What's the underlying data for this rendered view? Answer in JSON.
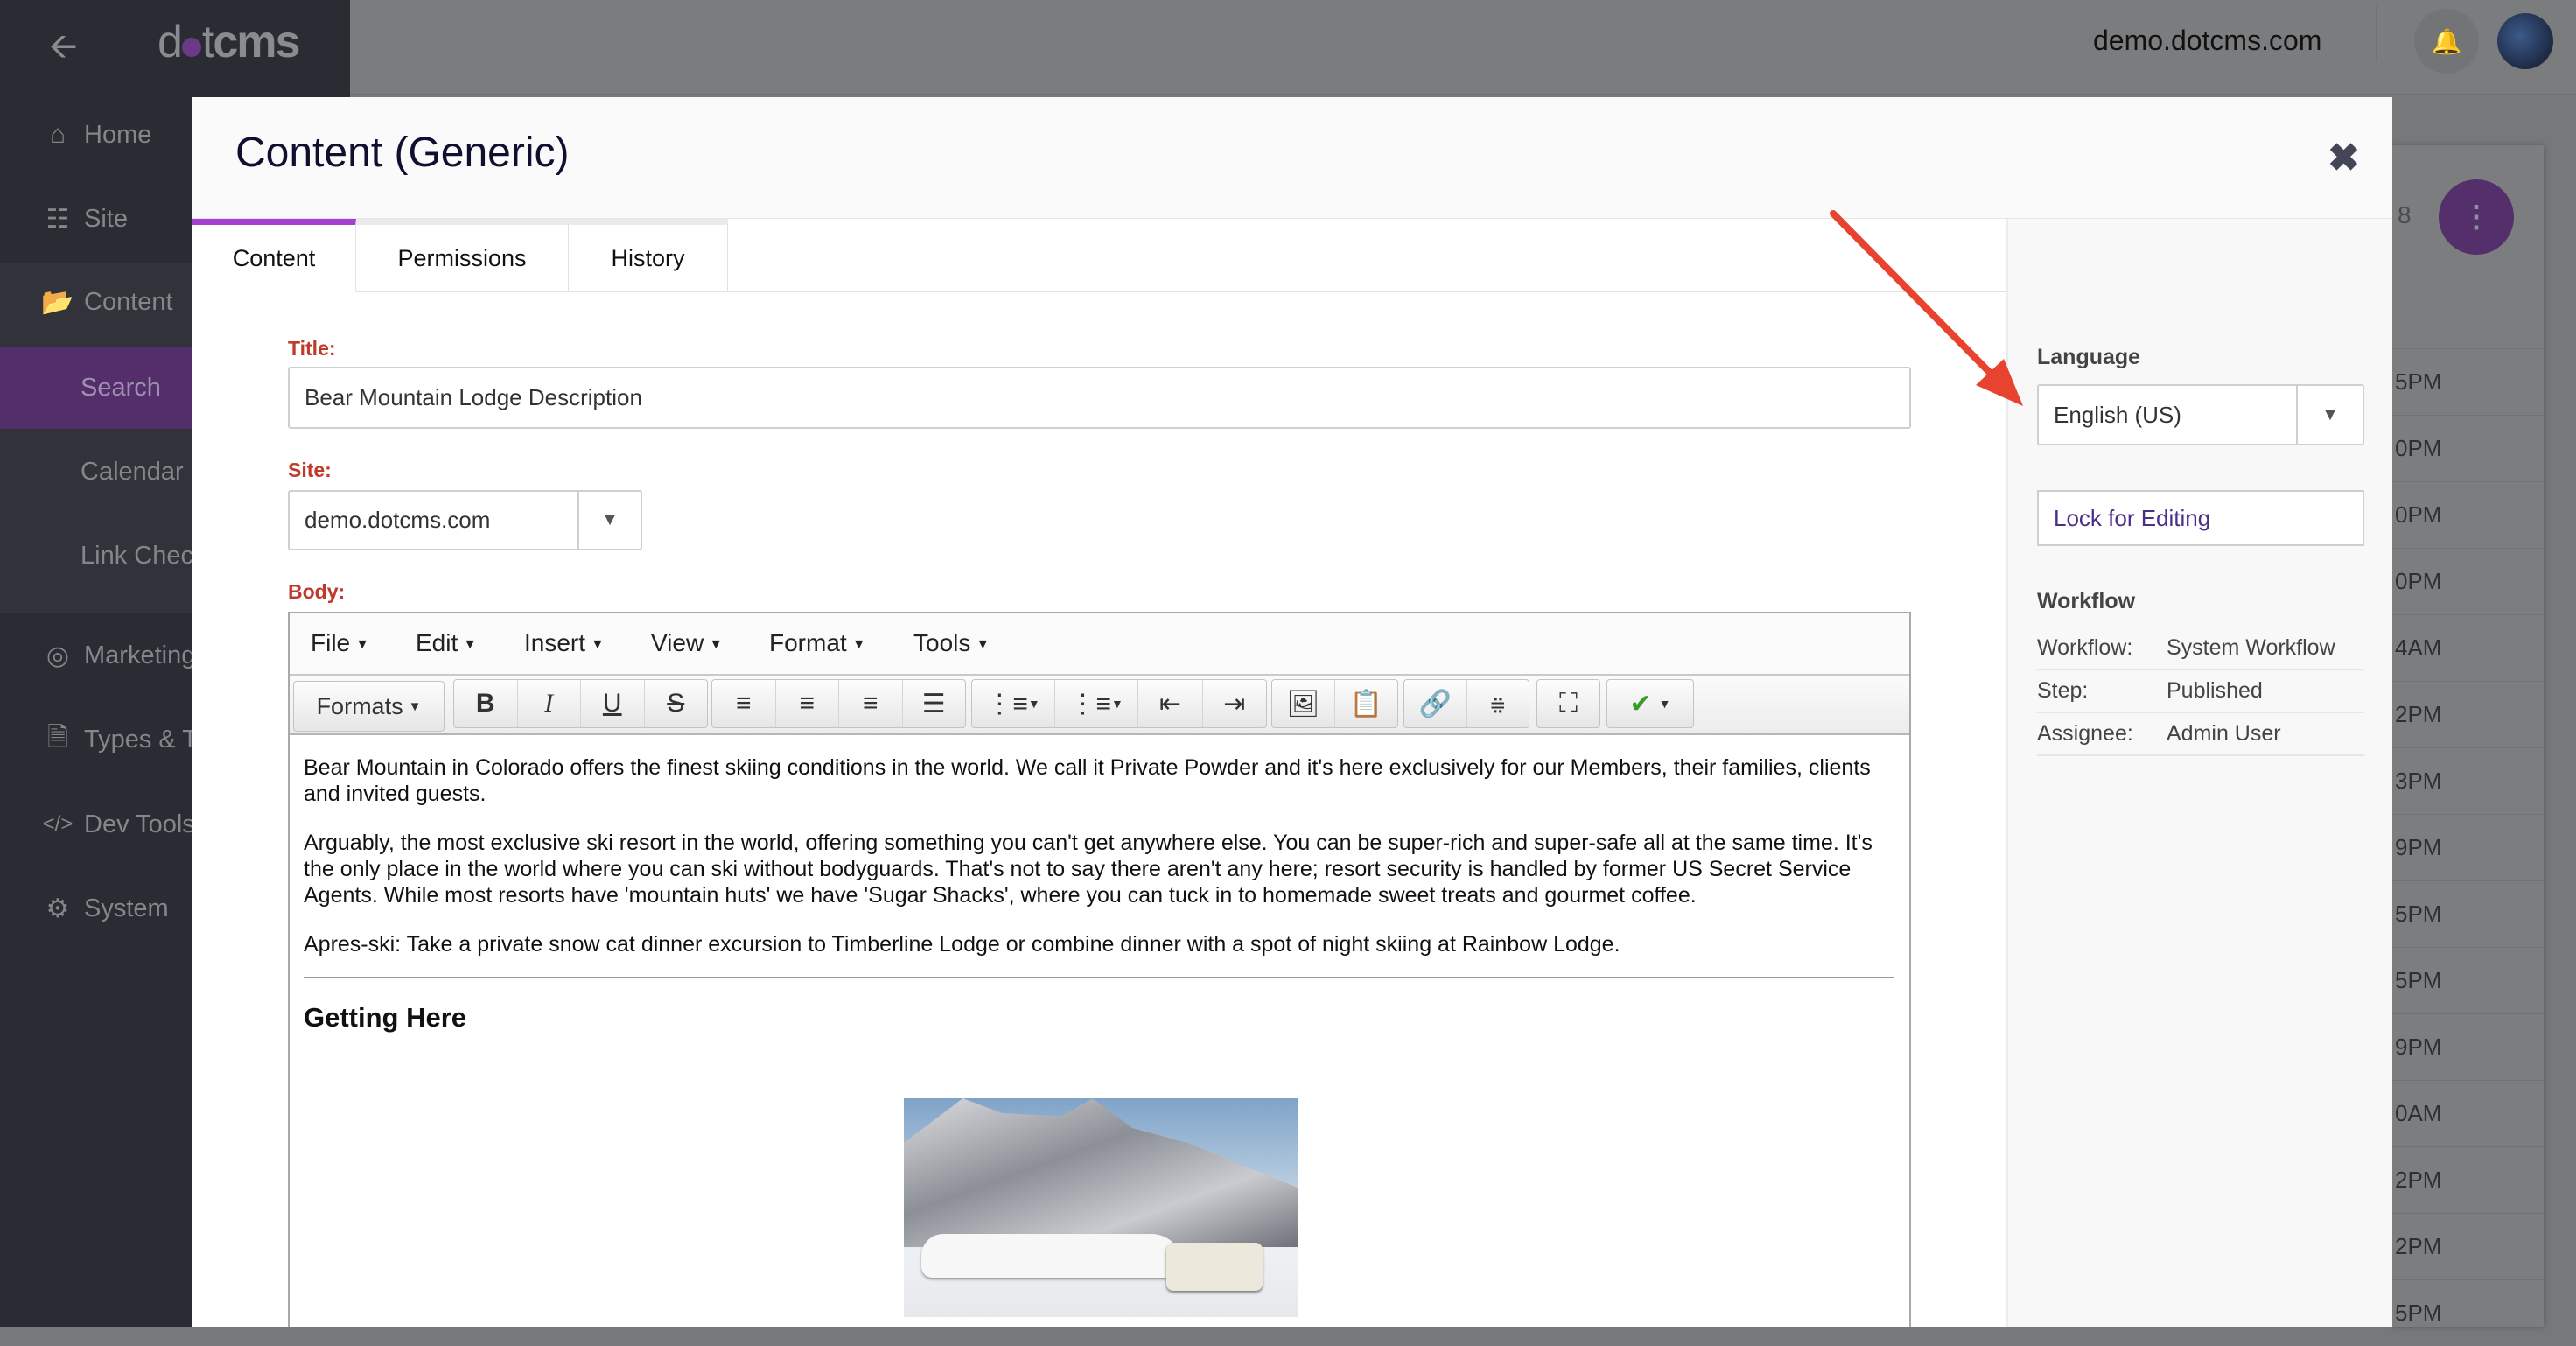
{
  "topbar": {
    "site": "demo.dotcms.com",
    "back_icon": "arrow-left-icon",
    "bell_icon": "bell-icon"
  },
  "logo": {
    "text_a": "d",
    "text_b": "t",
    "text_c": "cms"
  },
  "sidebar": {
    "items": [
      {
        "label": "Home",
        "icon": "home-icon"
      },
      {
        "label": "Site",
        "icon": "sitemap-icon"
      },
      {
        "label": "Content",
        "icon": "folder-open-icon"
      },
      {
        "label": "Search"
      },
      {
        "label": "Calendar"
      },
      {
        "label": "Link Check"
      },
      {
        "label": "Marketing",
        "icon": "target-icon"
      },
      {
        "label": "Types & Ta",
        "icon": "file-icon"
      },
      {
        "label": "Dev Tools",
        "icon": "code-icon"
      },
      {
        "label": "System",
        "icon": "gear-icon"
      }
    ]
  },
  "background": {
    "count_fragment": "8",
    "times": [
      "5PM",
      "0PM",
      "0PM",
      "0PM",
      "4AM",
      "2PM",
      "3PM",
      "9PM",
      "5PM",
      "5PM",
      "9PM",
      "0AM",
      "2PM",
      "2PM",
      "5PM"
    ]
  },
  "modal": {
    "title": "Content (Generic)",
    "tabs": [
      {
        "label": "Content"
      },
      {
        "label": "Permissions"
      },
      {
        "label": "History"
      }
    ],
    "fields": {
      "title_label": "Title:",
      "title_value": "Bear Mountain Lodge Description",
      "site_label": "Site:",
      "site_value": "demo.dotcms.com",
      "body_label": "Body:"
    },
    "editor": {
      "menus": [
        "File",
        "Edit",
        "Insert",
        "View",
        "Format",
        "Tools"
      ],
      "formats_label": "Formats",
      "paragraphs": [
        "Bear Mountain in Colorado offers the finest skiing conditions in the world. We call it Private Powder and it's here exclusively for our Members, their families, clients and invited guests.",
        "Arguably, the most exclusive ski resort in the world, offering something you can't get anywhere else. You can be super-rich and super-safe all at the same time. It's the only place in the world where you can ski without bodyguards. That's not to say there aren't any here; resort security is handled by former US Secret Service Agents. While most resorts have 'mountain huts' we have 'Sugar Shacks', where you can tuck in to homemade sweet treats and gourmet coffee.",
        "Apres-ski: Take a private snow cat dinner excursion to Timberline Lodge or combine dinner with a spot of night skiing at Rainbow Lodge."
      ],
      "heading": "Getting Here"
    },
    "side": {
      "language_label": "Language",
      "language_value": "English (US)",
      "lock_label": "Lock for Editing",
      "workflow_heading": "Workflow",
      "rows": [
        {
          "k": "Workflow:",
          "v": "System Workflow"
        },
        {
          "k": "Step:",
          "v": "Published"
        },
        {
          "k": "Assignee:",
          "v": "Admin User"
        }
      ]
    }
  },
  "colors": {
    "accent": "#a53fd3",
    "sidebar_active": "#542d6b",
    "label": "#c0392b",
    "annotation_arrow": "#e8432f"
  }
}
